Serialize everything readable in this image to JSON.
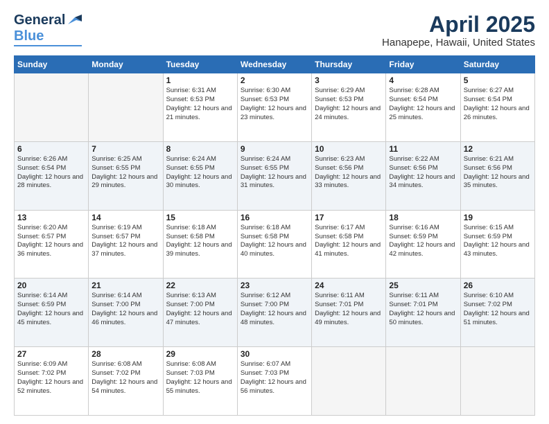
{
  "header": {
    "logo_general": "General",
    "logo_blue": "Blue",
    "month": "April 2025",
    "location": "Hanapepe, Hawaii, United States"
  },
  "days_of_week": [
    "Sunday",
    "Monday",
    "Tuesday",
    "Wednesday",
    "Thursday",
    "Friday",
    "Saturday"
  ],
  "weeks": [
    [
      {
        "day": "",
        "sunrise": "",
        "sunset": "",
        "daylight": ""
      },
      {
        "day": "",
        "sunrise": "",
        "sunset": "",
        "daylight": ""
      },
      {
        "day": "1",
        "sunrise": "Sunrise: 6:31 AM",
        "sunset": "Sunset: 6:53 PM",
        "daylight": "Daylight: 12 hours and 21 minutes."
      },
      {
        "day": "2",
        "sunrise": "Sunrise: 6:30 AM",
        "sunset": "Sunset: 6:53 PM",
        "daylight": "Daylight: 12 hours and 23 minutes."
      },
      {
        "day": "3",
        "sunrise": "Sunrise: 6:29 AM",
        "sunset": "Sunset: 6:53 PM",
        "daylight": "Daylight: 12 hours and 24 minutes."
      },
      {
        "day": "4",
        "sunrise": "Sunrise: 6:28 AM",
        "sunset": "Sunset: 6:54 PM",
        "daylight": "Daylight: 12 hours and 25 minutes."
      },
      {
        "day": "5",
        "sunrise": "Sunrise: 6:27 AM",
        "sunset": "Sunset: 6:54 PM",
        "daylight": "Daylight: 12 hours and 26 minutes."
      }
    ],
    [
      {
        "day": "6",
        "sunrise": "Sunrise: 6:26 AM",
        "sunset": "Sunset: 6:54 PM",
        "daylight": "Daylight: 12 hours and 28 minutes."
      },
      {
        "day": "7",
        "sunrise": "Sunrise: 6:25 AM",
        "sunset": "Sunset: 6:55 PM",
        "daylight": "Daylight: 12 hours and 29 minutes."
      },
      {
        "day": "8",
        "sunrise": "Sunrise: 6:24 AM",
        "sunset": "Sunset: 6:55 PM",
        "daylight": "Daylight: 12 hours and 30 minutes."
      },
      {
        "day": "9",
        "sunrise": "Sunrise: 6:24 AM",
        "sunset": "Sunset: 6:55 PM",
        "daylight": "Daylight: 12 hours and 31 minutes."
      },
      {
        "day": "10",
        "sunrise": "Sunrise: 6:23 AM",
        "sunset": "Sunset: 6:56 PM",
        "daylight": "Daylight: 12 hours and 33 minutes."
      },
      {
        "day": "11",
        "sunrise": "Sunrise: 6:22 AM",
        "sunset": "Sunset: 6:56 PM",
        "daylight": "Daylight: 12 hours and 34 minutes."
      },
      {
        "day": "12",
        "sunrise": "Sunrise: 6:21 AM",
        "sunset": "Sunset: 6:56 PM",
        "daylight": "Daylight: 12 hours and 35 minutes."
      }
    ],
    [
      {
        "day": "13",
        "sunrise": "Sunrise: 6:20 AM",
        "sunset": "Sunset: 6:57 PM",
        "daylight": "Daylight: 12 hours and 36 minutes."
      },
      {
        "day": "14",
        "sunrise": "Sunrise: 6:19 AM",
        "sunset": "Sunset: 6:57 PM",
        "daylight": "Daylight: 12 hours and 37 minutes."
      },
      {
        "day": "15",
        "sunrise": "Sunrise: 6:18 AM",
        "sunset": "Sunset: 6:58 PM",
        "daylight": "Daylight: 12 hours and 39 minutes."
      },
      {
        "day": "16",
        "sunrise": "Sunrise: 6:18 AM",
        "sunset": "Sunset: 6:58 PM",
        "daylight": "Daylight: 12 hours and 40 minutes."
      },
      {
        "day": "17",
        "sunrise": "Sunrise: 6:17 AM",
        "sunset": "Sunset: 6:58 PM",
        "daylight": "Daylight: 12 hours and 41 minutes."
      },
      {
        "day": "18",
        "sunrise": "Sunrise: 6:16 AM",
        "sunset": "Sunset: 6:59 PM",
        "daylight": "Daylight: 12 hours and 42 minutes."
      },
      {
        "day": "19",
        "sunrise": "Sunrise: 6:15 AM",
        "sunset": "Sunset: 6:59 PM",
        "daylight": "Daylight: 12 hours and 43 minutes."
      }
    ],
    [
      {
        "day": "20",
        "sunrise": "Sunrise: 6:14 AM",
        "sunset": "Sunset: 6:59 PM",
        "daylight": "Daylight: 12 hours and 45 minutes."
      },
      {
        "day": "21",
        "sunrise": "Sunrise: 6:14 AM",
        "sunset": "Sunset: 7:00 PM",
        "daylight": "Daylight: 12 hours and 46 minutes."
      },
      {
        "day": "22",
        "sunrise": "Sunrise: 6:13 AM",
        "sunset": "Sunset: 7:00 PM",
        "daylight": "Daylight: 12 hours and 47 minutes."
      },
      {
        "day": "23",
        "sunrise": "Sunrise: 6:12 AM",
        "sunset": "Sunset: 7:00 PM",
        "daylight": "Daylight: 12 hours and 48 minutes."
      },
      {
        "day": "24",
        "sunrise": "Sunrise: 6:11 AM",
        "sunset": "Sunset: 7:01 PM",
        "daylight": "Daylight: 12 hours and 49 minutes."
      },
      {
        "day": "25",
        "sunrise": "Sunrise: 6:11 AM",
        "sunset": "Sunset: 7:01 PM",
        "daylight": "Daylight: 12 hours and 50 minutes."
      },
      {
        "day": "26",
        "sunrise": "Sunrise: 6:10 AM",
        "sunset": "Sunset: 7:02 PM",
        "daylight": "Daylight: 12 hours and 51 minutes."
      }
    ],
    [
      {
        "day": "27",
        "sunrise": "Sunrise: 6:09 AM",
        "sunset": "Sunset: 7:02 PM",
        "daylight": "Daylight: 12 hours and 52 minutes."
      },
      {
        "day": "28",
        "sunrise": "Sunrise: 6:08 AM",
        "sunset": "Sunset: 7:02 PM",
        "daylight": "Daylight: 12 hours and 54 minutes."
      },
      {
        "day": "29",
        "sunrise": "Sunrise: 6:08 AM",
        "sunset": "Sunset: 7:03 PM",
        "daylight": "Daylight: 12 hours and 55 minutes."
      },
      {
        "day": "30",
        "sunrise": "Sunrise: 6:07 AM",
        "sunset": "Sunset: 7:03 PM",
        "daylight": "Daylight: 12 hours and 56 minutes."
      },
      {
        "day": "",
        "sunrise": "",
        "sunset": "",
        "daylight": ""
      },
      {
        "day": "",
        "sunrise": "",
        "sunset": "",
        "daylight": ""
      },
      {
        "day": "",
        "sunrise": "",
        "sunset": "",
        "daylight": ""
      }
    ]
  ]
}
